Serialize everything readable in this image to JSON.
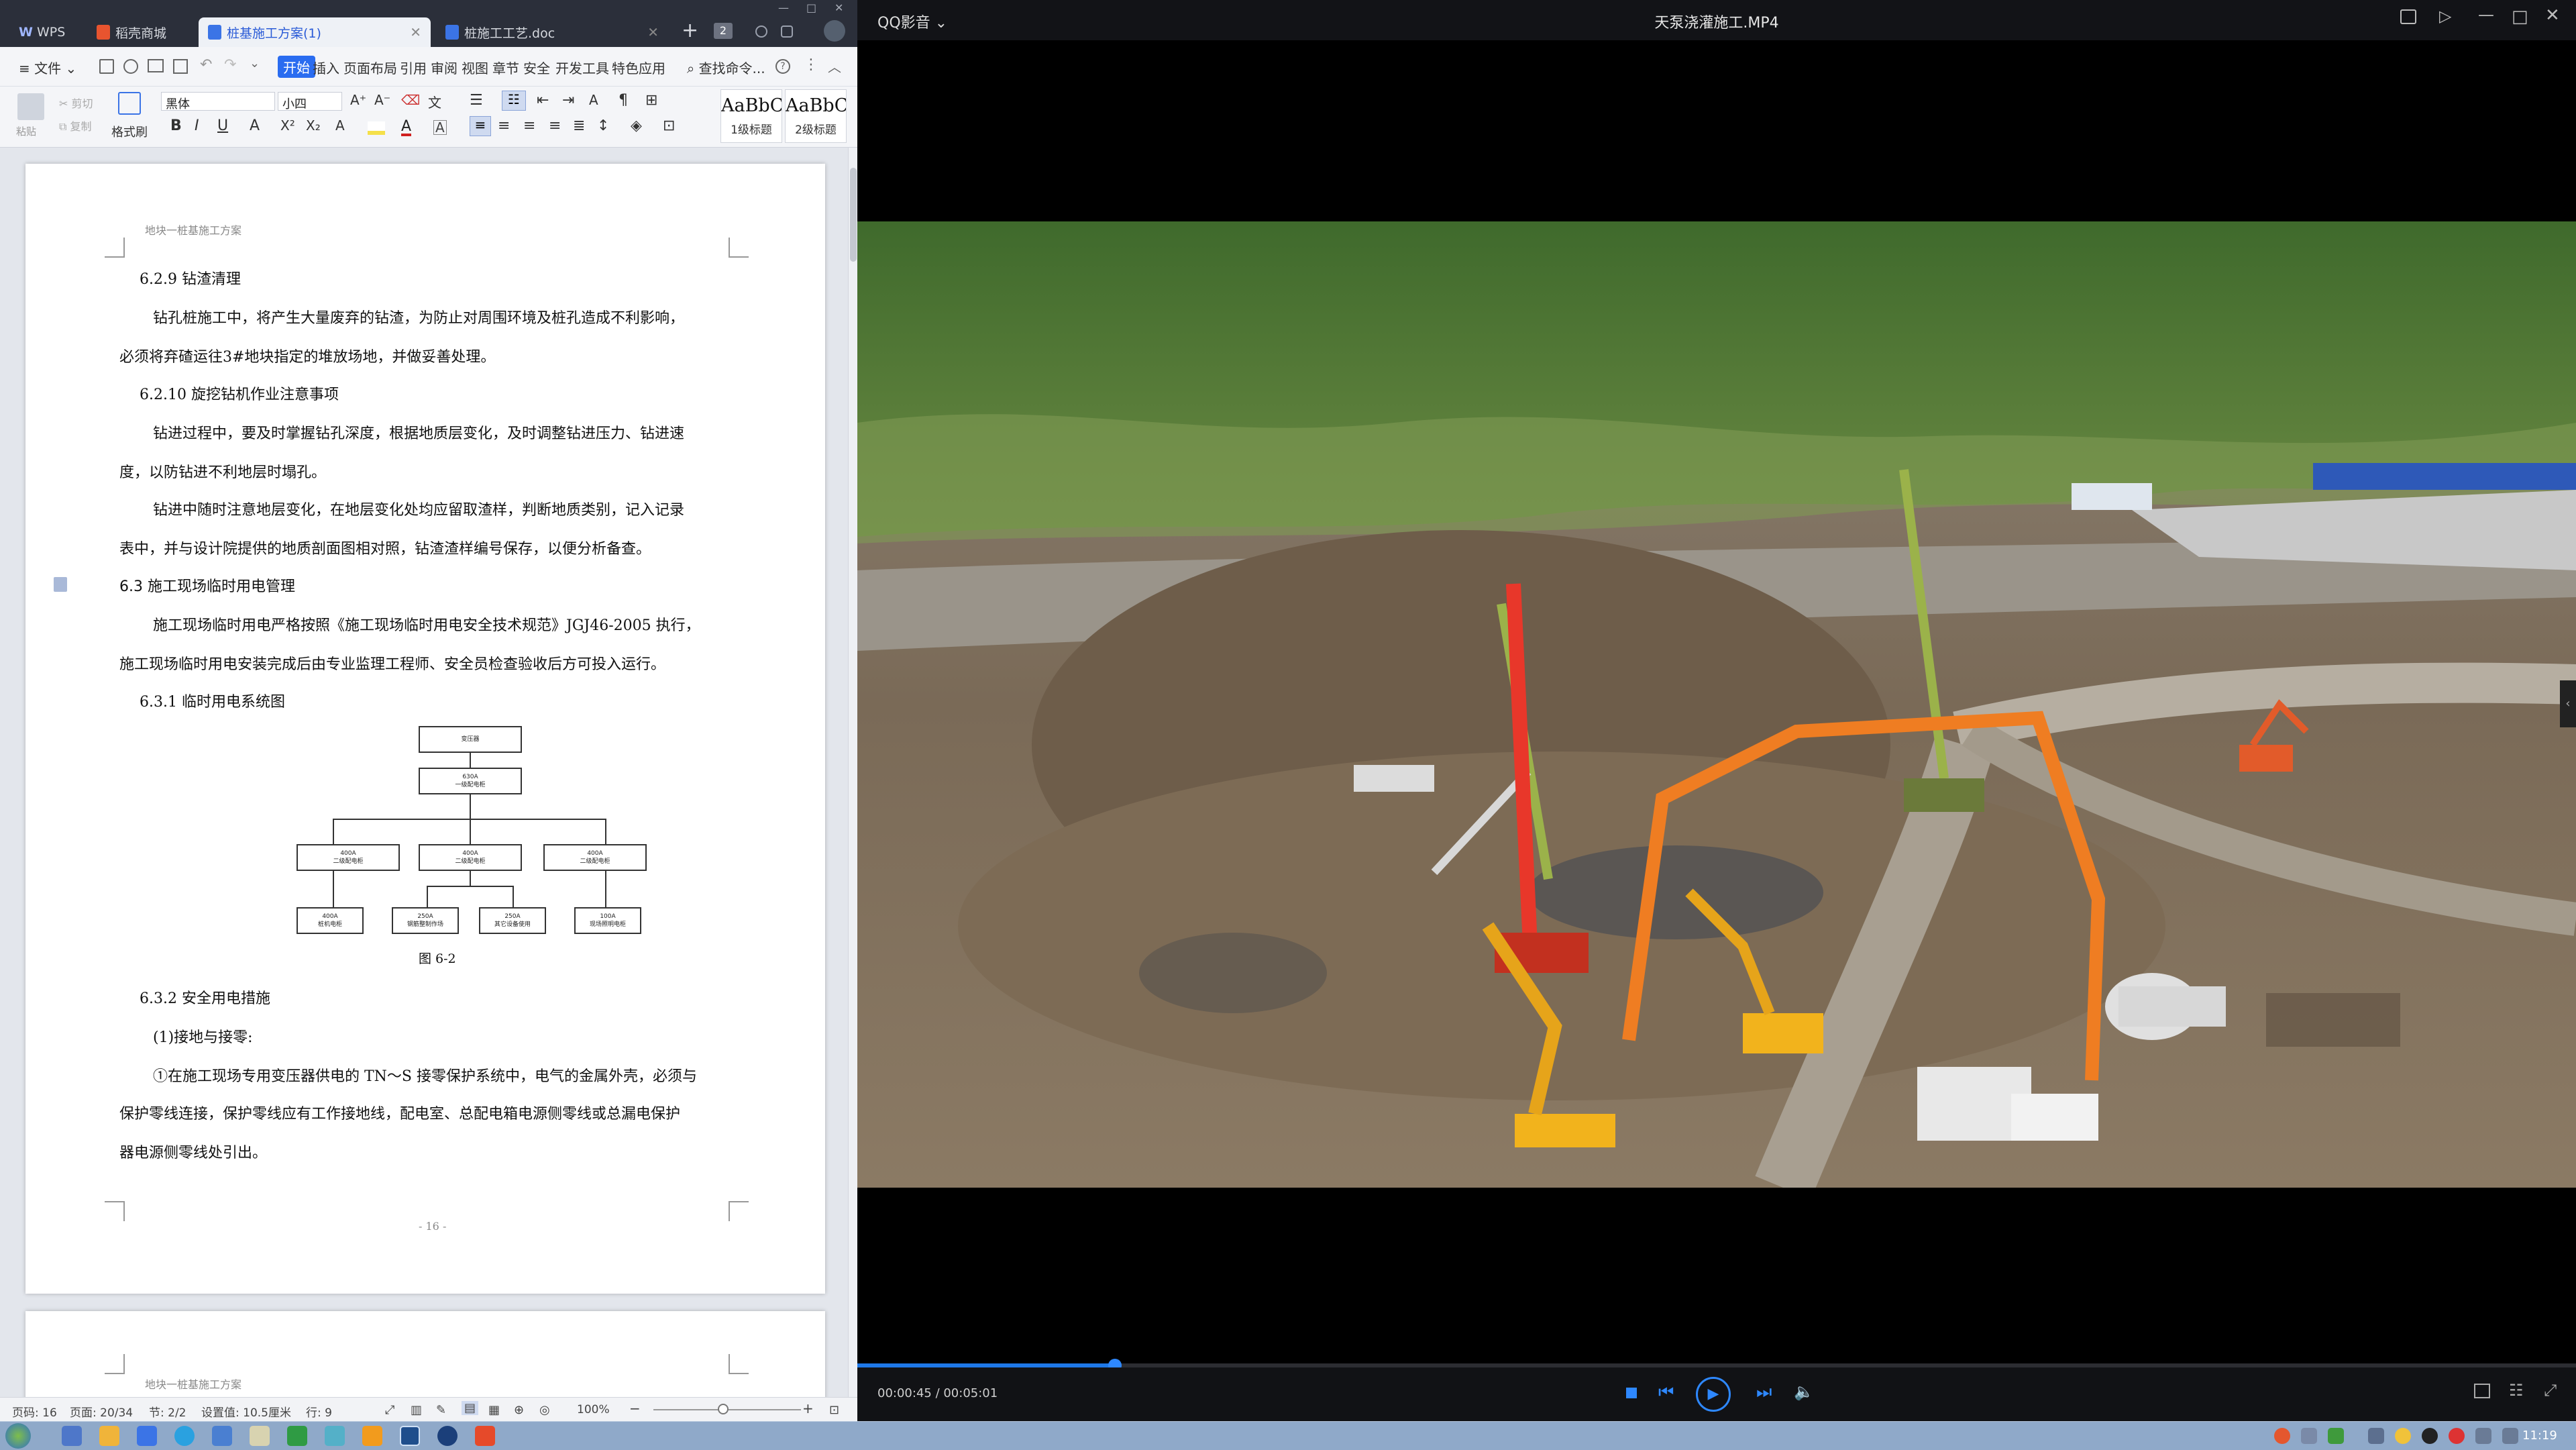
{
  "wps": {
    "tabs": [
      {
        "label": "WPS"
      },
      {
        "label": "稻壳商城"
      },
      {
        "label": "桩基施工方案(1)"
      },
      {
        "label": "桩施工工艺.doc"
      }
    ],
    "tab_count_badge": "2",
    "menu": {
      "file": "文件",
      "items": [
        "开始",
        "插入",
        "页面布局",
        "引用",
        "审阅",
        "视图",
        "章节",
        "安全",
        "开发工具",
        "特色应用"
      ],
      "search": "查找命令..."
    },
    "ribbon": {
      "paste": "粘贴",
      "cut": "剪切",
      "copy": "复制",
      "format_painter": "格式刷",
      "font_name": "黑体",
      "font_size": "小四",
      "styles": [
        {
          "sample": "AaBbCcDd",
          "label": "1级标题"
        },
        {
          "sample": "AaBbCcDd",
          "label": "2级标题"
        }
      ]
    },
    "page1": {
      "header": "地块一桩基施工方案",
      "h_629": "6.2.9  钻渣清理",
      "p1_l1": "钻孔桩施工中，将产生大量废弃的钻渣，为防止对周围环境及桩孔造成不利影响，",
      "p1_l2": "必须将弃碴运往3#地块指定的堆放场地，并做妥善处理。",
      "h_6210": "6.2.10  旋挖钻机作业注意事项",
      "p2_l1": "钻进过程中，要及时掌握钻孔深度，根据地质层变化，及时调整钻进压力、钻进速",
      "p2_l2": "度，以防钻进不利地层时塌孔。",
      "p3_l1": "钻进中随时注意地层变化，在地层变化处均应留取渣样，判断地质类别，记入记录",
      "p3_l2": "表中，并与设计院提供的地质剖面图相对照，钻渣渣样编号保存，以便分析备查。",
      "h_63": "6.3  施工现场临时用电管理",
      "p4_l1": "施工现场临时用电严格按照《施工现场临时用电安全技术规范》JGJ46-2005 执行，",
      "p4_l2": "施工现场临时用电安装完成后由专业监理工程师、安全员检查验收后方可投入运行。",
      "h_631": "6.3.1  临时用电系统图",
      "fig_caption": "图 6-2",
      "h_632": "6.3.2  安全用电措施",
      "p5": "(1)接地与接零:",
      "p6_l1": "①在施工现场专用变压器供电的 TN～S 接零保护系统中，电气的金属外壳，必须与",
      "p6_l2": "保护零线连接，保护零线应有工作接地线，配电室、总配电箱电源侧零线或总漏电保护",
      "p6_l3": "器电源侧零线处引出。",
      "page_number": "- 16 -"
    },
    "diagram": {
      "top": "变压器",
      "main_a": "630A",
      "main_b": "一级配电柜",
      "mid": [
        {
          "a": "400A",
          "b": "二级配电柜"
        },
        {
          "a": "400A",
          "b": "二级配电柜"
        },
        {
          "a": "400A",
          "b": "二级配电柜"
        }
      ],
      "bottom": [
        {
          "a": "400A",
          "b": "桩机电柜"
        },
        {
          "a": "250A",
          "b": "钢筋整制作场"
        },
        {
          "a": "250A",
          "b": "其它设备使用"
        },
        {
          "a": "100A",
          "b": "现场照明电柜"
        }
      ]
    },
    "page2": {
      "header": "地块一桩基施工方案"
    },
    "status": {
      "page_num": "页码: 16",
      "pages": "页面: 20/34",
      "section": "节: 2/2",
      "setting": "设置值: 10.5厘米",
      "row": "行: 9",
      "zoom": "100%"
    }
  },
  "qq": {
    "app_name": "QQ影音",
    "file_title": "天泵浇灌施工.MP4",
    "time_current": "00:00:45",
    "time_total": "00:05:01",
    "progress": 0.15
  },
  "taskbar": {
    "clock": "11:19"
  },
  "colors": {
    "accent_blue": "#2a6cf0",
    "progress_blue": "#1e78e8",
    "wps_dark": "#2b2f3a"
  }
}
